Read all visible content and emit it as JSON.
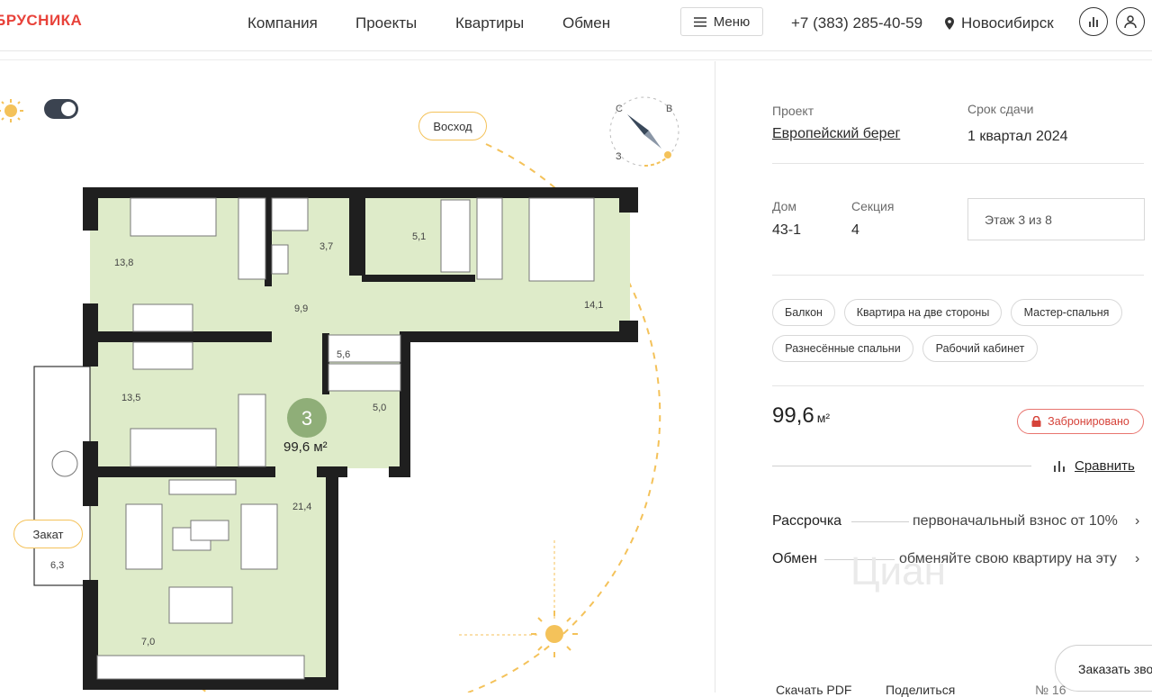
{
  "header": {
    "logo": "БРУСНИКА",
    "nav": [
      "Компания",
      "Проекты",
      "Квартиры",
      "Обмен"
    ],
    "menu_label": "Меню",
    "phone": "+7 (383) 285-40-59",
    "city": "Новосибирск"
  },
  "plan": {
    "sunrise_label": "Восход",
    "sunset_label": "Закат",
    "compass": {
      "n": "С",
      "e": "В",
      "w": "З"
    },
    "rooms_count": "3",
    "total_area": "99,6 м²",
    "room_areas": [
      "13,8",
      "3,7",
      "5,1",
      "14,1",
      "9,9",
      "5,6",
      "5,0",
      "13,5",
      "21,4",
      "6,3",
      "7,0"
    ],
    "theme_toggle_on": true
  },
  "panel": {
    "project_label": "Проект",
    "project_value": "Европейский берег",
    "deadline_label": "Срок сдачи",
    "deadline_value": "1 квартал 2024",
    "house_label": "Дом",
    "house_value": "43-1",
    "section_label": "Секция",
    "section_value": "4",
    "floor": "Этаж 3 из 8",
    "tags": [
      "Балкон",
      "Квартира на две стороны",
      "Мастер-спальня",
      "Разнесённые спальни",
      "Рабочий кабинет"
    ],
    "area_value": "99,6",
    "area_unit": "м²",
    "status": "Забронировано",
    "compare": "Сравнить",
    "installment_label": "Рассрочка",
    "installment_value": "первоначальный взнос от 10%",
    "exchange_label": "Обмен",
    "exchange_value": "обменяйте свою квартиру на эту",
    "order_call": "Заказать звонок",
    "download_pdf": "Скачать PDF",
    "share": "Поделиться",
    "flat_number": "№ 16",
    "watermark": "Циан"
  },
  "colors": {
    "accent": "#e8423a",
    "room_fill": "#deebc9",
    "wall": "#1f1f1f",
    "sun": "#f4c25a",
    "status": "#d6433a"
  }
}
